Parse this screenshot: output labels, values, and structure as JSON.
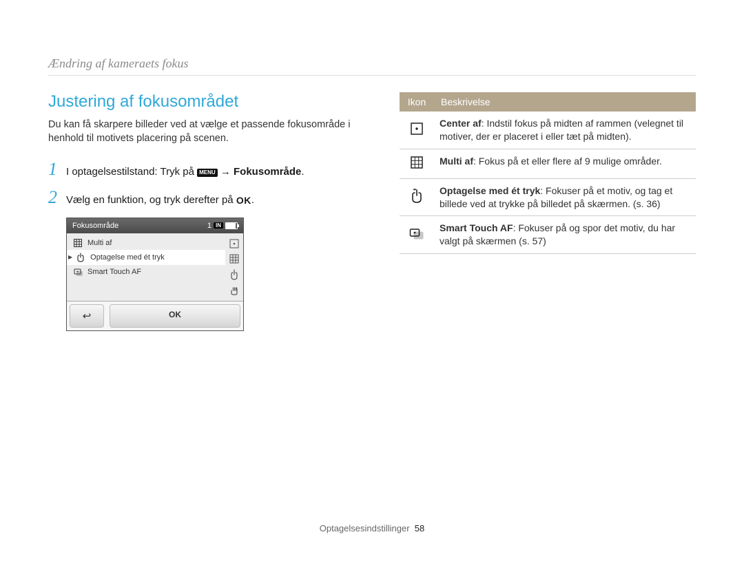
{
  "breadcrumb": "Ændring af kameraets fokus",
  "heading": "Justering af fokusområdet",
  "intro": "Du kan få skarpere billeder ved at vælge et passende fokusområde i henhold til motivets placering på scenen.",
  "steps": {
    "s1": {
      "prefix": "I optagelsestilstand: Tryk på ",
      "menu_icon_text": "MENU",
      "arrow": " → ",
      "bold_target": "Fokusområde",
      "suffix": "."
    },
    "s2": {
      "prefix": "Vælg en funktion, og tryk derefter på ",
      "ok_label": "OK",
      "suffix": "."
    }
  },
  "screen": {
    "title": "Fokusområde",
    "count": "1",
    "storage": "IN",
    "items": {
      "multi": "Multi af",
      "onetouch": "Optagelse med ét tryk",
      "smart": "Smart Touch AF"
    },
    "back_label": "↩",
    "ok_label": "OK"
  },
  "table": {
    "headers": {
      "icon": "Ikon",
      "desc": "Beskrivelse"
    },
    "rows": {
      "center": {
        "name": "Center af",
        "text": ": Indstil fokus på midten af rammen (velegnet til motiver, der er placeret i eller tæt på midten)."
      },
      "multi": {
        "name": "Multi af",
        "text": ": Fokus på et eller flere af 9 mulige områder."
      },
      "onetouch": {
        "name": "Optagelse med ét tryk",
        "text": ": Fokuser på et motiv, og tag et billede ved at trykke på billedet på skærmen. (s. 36)"
      },
      "smart": {
        "name": "Smart Touch AF",
        "text": ": Fokuser på og spor det motiv, du har valgt på skærmen (s. 57)"
      }
    }
  },
  "footer": {
    "section": "Optagelsesindstillinger",
    "page": "58"
  }
}
